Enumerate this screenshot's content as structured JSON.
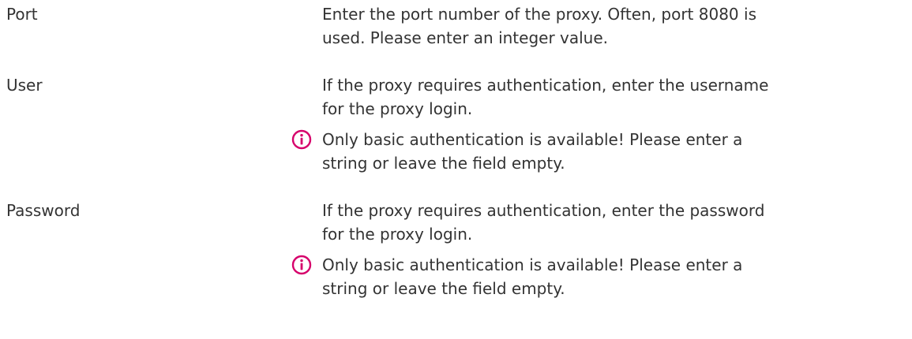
{
  "accent_color": "#d6006b",
  "rows": [
    {
      "label": "Port",
      "description": "Enter the port number of the proxy. Often, port 8080 is used. Please enter an integer value.",
      "note": null
    },
    {
      "label": "User",
      "description": "If the proxy requires authentication, enter the username for the proxy login.",
      "note": {
        "icon": "info-icon",
        "text": "Only basic authentication is available! Please enter a string or leave the field empty."
      }
    },
    {
      "label": "Password",
      "description": "If the proxy requires authentication, enter the password for the proxy login.",
      "note": {
        "icon": "info-icon",
        "text": "Only basic authentication is available! Please enter a string or leave the field empty."
      }
    }
  ]
}
